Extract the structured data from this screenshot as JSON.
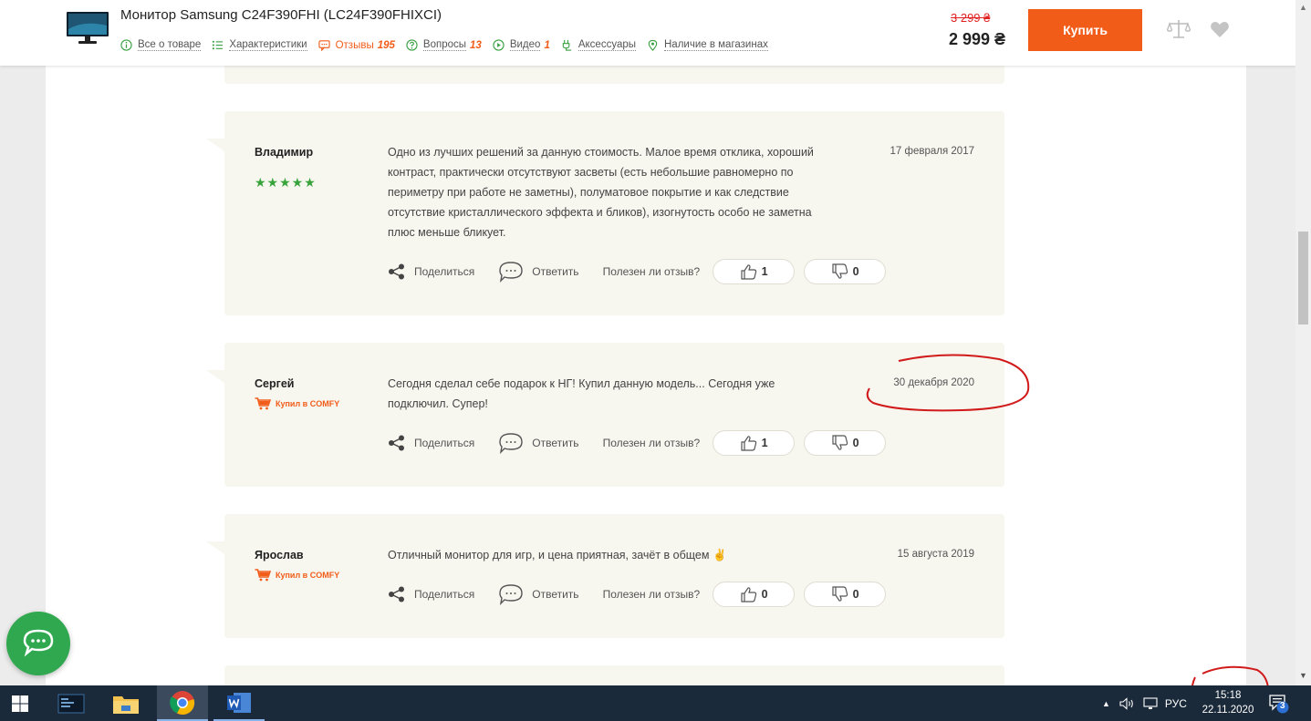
{
  "header": {
    "product_title": "Монитор Samsung C24F390FHI (LC24F390FHIXCI)",
    "tabs": [
      {
        "label": "Все о товаре",
        "icon": "info-icon"
      },
      {
        "label": "Характеристики",
        "icon": "list-icon"
      },
      {
        "label": "Отзывы",
        "count": "195",
        "icon": "comment-icon"
      },
      {
        "label": "Вопросы",
        "count": "13",
        "icon": "question-icon"
      },
      {
        "label": "Видео",
        "count": "1",
        "icon": "play-icon"
      },
      {
        "label": "Аксессуары",
        "icon": "plug-icon"
      },
      {
        "label": "Наличие в магазинах",
        "icon": "location-pin-icon"
      }
    ],
    "old_price": "3 299 ₴",
    "price": "2 999 ₴",
    "buy_label": "Купить"
  },
  "reviews": [
    {
      "author": "Владимир",
      "stars": "★★★★★",
      "date": "17 февраля 2017",
      "text": "Одно из лучших решений за данную стоимость. Малое время отклика, хороший контраст, практически отсутствуют засветы (есть небольшие равномерно по периметру при работе не заметны), полуматовое покрытие и как следствие отсутствие кристаллического эффекта и бликов), изогнутость особо не заметна плюс меньше бликует.",
      "likes": "1",
      "dislikes": "0"
    },
    {
      "author": "Сергей",
      "badge": "Купил в COMFY",
      "date": "30 декабря 2020",
      "text": "Сегодня сделал себе подарок к НГ! Купил данную модель... Сегодня уже подключил. Супер!",
      "likes": "1",
      "dislikes": "0"
    },
    {
      "author": "Ярослав",
      "badge": "Купил в COMFY",
      "date": "15 августа 2019",
      "text": "Отличный монитор для игр, и цена приятная, зачёт в общем ✌",
      "likes": "0",
      "dislikes": "0"
    }
  ],
  "actions": {
    "share": "Поделиться",
    "reply": "Ответить",
    "helpful": "Полезен ли отзыв?"
  },
  "taskbar": {
    "language": "РУС",
    "time": "15:18",
    "date": "22.11.2020",
    "notifications": "3"
  },
  "colors": {
    "accent": "#f25c19",
    "review_bg": "#f7f6ef",
    "stars": "#37a33a",
    "chat": "#2fa84f",
    "annotation": "#d11a1a"
  }
}
